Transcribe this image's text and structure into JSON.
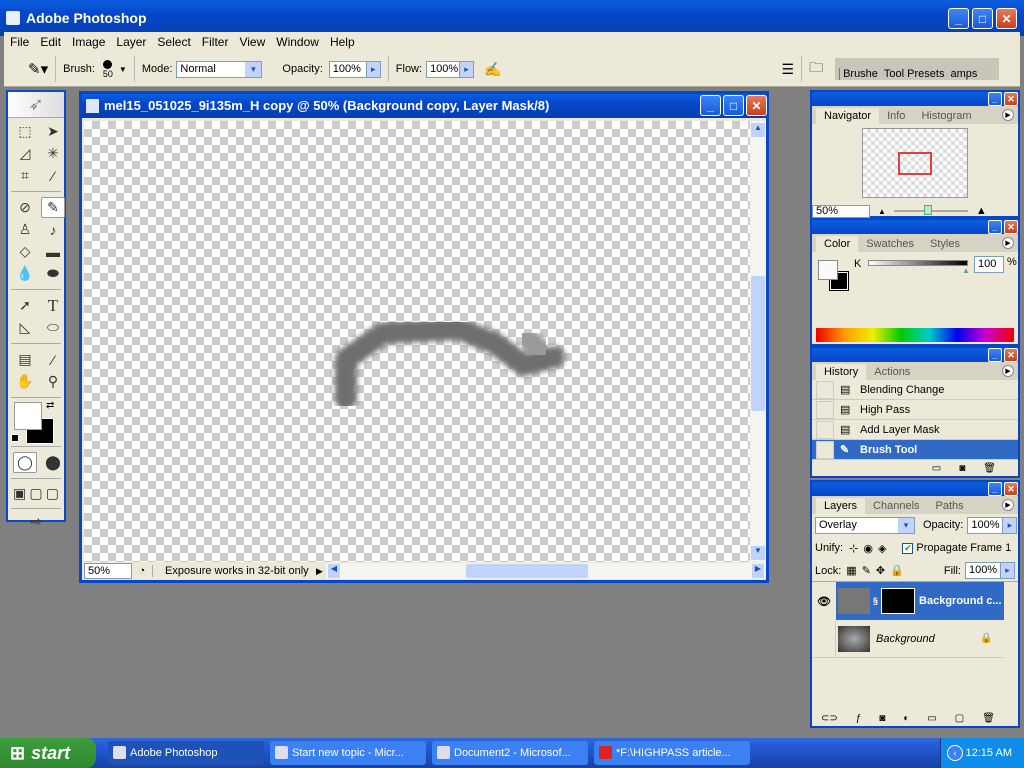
{
  "app": {
    "title": "Adobe Photoshop"
  },
  "menu": [
    "File",
    "Edit",
    "Image",
    "Layer",
    "Select",
    "Filter",
    "View",
    "Window",
    "Help"
  ],
  "options": {
    "brush_label": "Brush:",
    "brush_size": "50",
    "mode_label": "Mode:",
    "mode_value": "Normal",
    "opacity_label": "Opacity:",
    "opacity_value": "100%",
    "flow_label": "Flow:",
    "flow_value": "100%",
    "well_tabs": [
      "Brushe",
      "Tool Presets",
      "amps"
    ]
  },
  "document": {
    "title": "mel15_051025_9i135m_H copy @ 50% (Background copy, Layer Mask/8)",
    "zoom": "50%",
    "status": "Exposure works in 32-bit only"
  },
  "navigator": {
    "tabs": [
      "Navigator",
      "Info",
      "Histogram"
    ],
    "zoom": "50%"
  },
  "color": {
    "tabs": [
      "Color",
      "Swatches",
      "Styles"
    ],
    "channel": "K",
    "value": "100",
    "unit": "%"
  },
  "history": {
    "tabs": [
      "History",
      "Actions"
    ],
    "items": [
      "Blending Change",
      "High Pass",
      "Add Layer Mask",
      "Brush Tool"
    ]
  },
  "layers": {
    "tabs": [
      "Layers",
      "Channels",
      "Paths"
    ],
    "blend": "Overlay",
    "opacity_label": "Opacity:",
    "opacity": "100%",
    "unify_label": "Unify:",
    "propagate": "Propagate Frame 1",
    "lock_label": "Lock:",
    "fill_label": "Fill:",
    "fill": "100%",
    "items": [
      {
        "name": "Background c...",
        "selected": true
      },
      {
        "name": "Background",
        "selected": false
      }
    ]
  },
  "taskbar": {
    "start": "start",
    "tasks": [
      "Adobe Photoshop",
      "Start new topic - Micr...",
      "Document2 - Microsof...",
      "*F:\\HIGHPASS article..."
    ],
    "clock": "12:15 AM"
  }
}
